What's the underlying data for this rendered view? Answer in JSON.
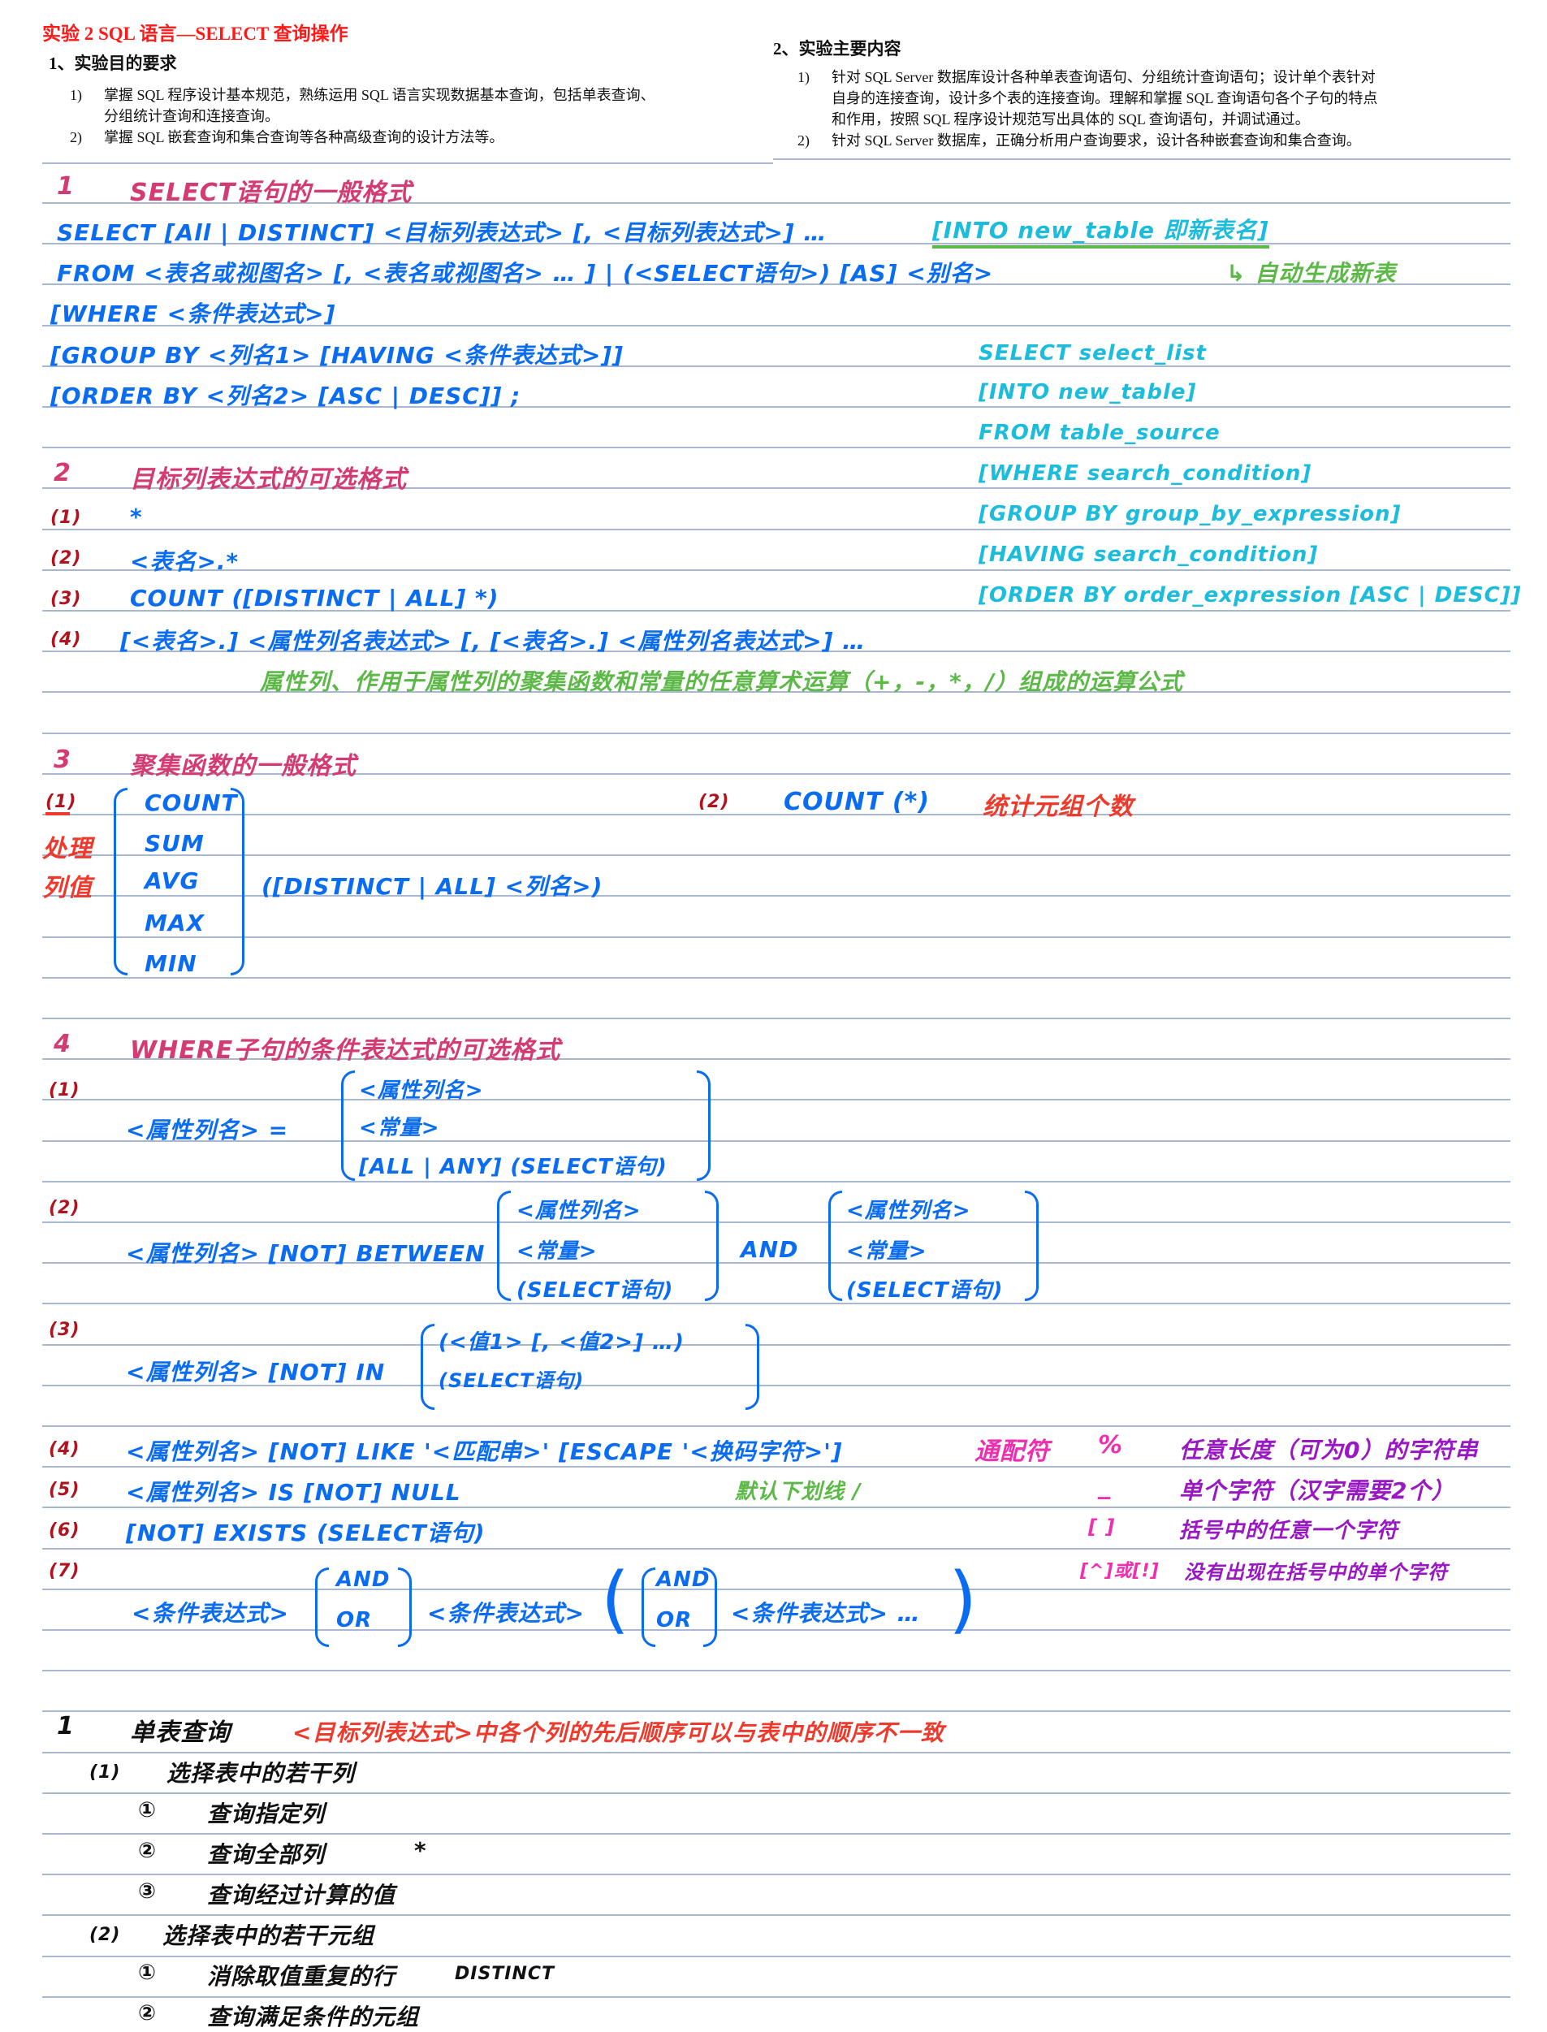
{
  "header": {
    "title": "实验 2   SQL 语言—SELECT 查询操作",
    "left": {
      "heading": "1、实验目的要求",
      "items": [
        {
          "num": "1)",
          "line1": "掌握 SQL 程序设计基本规范，熟练运用 SQL 语言实现数据基本查询，包括单表查询、",
          "line2": "分组统计查询和连接查询。"
        },
        {
          "num": "2)",
          "line1": "掌握 SQL 嵌套查询和集合查询等各种高级查询的设计方法等。"
        }
      ]
    },
    "right": {
      "heading": "2、实验主要内容",
      "items": [
        {
          "num": "1)",
          "line1": "针对 SQL Server 数据库设计各种单表查询语句、分组统计查询语句；设计单个表针对",
          "line2": "自身的连接查询，设计多个表的连接查询。理解和掌握 SQL 查询语句各个子句的特点",
          "line3": "和作用，按照 SQL 程序设计规范写出具体的 SQL 查询语句，并调试通过。"
        },
        {
          "num": "2)",
          "line1": "针对 SQL Server 数据库，正确分析用户查询要求，设计各种嵌套查询和集合查询。"
        }
      ]
    }
  },
  "section1": {
    "num": "1",
    "title": "SELECT语句的一般格式",
    "lines": [
      "SELECT [All | DISTINCT] <目标列表达式> [, <目标列表达式>] …",
      "FROM <表名或视图名> [, <表名或视图名> … ] | (<SELECT语句>) [AS] <别名>",
      "[WHERE <条件表达式>]",
      "[GROUP BY <列名1> [HAVING <条件表达式>]]",
      "[ORDER BY <列名2> [ASC | DESC]] ;"
    ],
    "into_note": "[INTO new_table 即新表名]",
    "auto_note": "↳ 自动生成新表",
    "english_syntax": [
      "SELECT select_list",
      "[INTO new_table]",
      "FROM table_source",
      "[WHERE search_condition]",
      "[GROUP BY group_by_expression]",
      "[HAVING search_condition]",
      "[ORDER BY order_expression [ASC | DESC]]"
    ]
  },
  "section2": {
    "num": "2",
    "title": "目标列表达式的可选格式",
    "items": [
      {
        "num": "(1)",
        "text": "*"
      },
      {
        "num": "(2)",
        "text": "<表名>.*"
      },
      {
        "num": "(3)",
        "text": "COUNT ([DISTINCT | ALL] *)"
      },
      {
        "num": "(4)",
        "text": "[<表名>.] <属性列名表达式> [, [<表名>.] <属性列名表达式>] …"
      }
    ],
    "note": "属性列、作用于属性列的聚集函数和常量的任意算术运算（+，-，*，/）组成的运算公式"
  },
  "section3": {
    "num": "3",
    "title": "聚集函数的一般格式",
    "item1_num": "(1)",
    "side_label": [
      "处理",
      "列值"
    ],
    "functions": [
      "COUNT",
      "SUM",
      "AVG",
      "MAX",
      "MIN"
    ],
    "args": "([DISTINCT | ALL] <列名>)",
    "item2_num": "(2)",
    "item2_code": "COUNT (*)",
    "item2_note": "统计元组个数"
  },
  "section4": {
    "num": "4",
    "title": "WHERE子句的条件表达式的可选格式",
    "f1": {
      "num": "(1)",
      "lhs": "<属性列名>  =",
      "options": [
        "<属性列名>",
        "<常量>",
        "[ALL | ANY] (SELECT语句)"
      ]
    },
    "f2": {
      "num": "(2)",
      "lhs": "<属性列名> [NOT] BETWEEN",
      "options_a": [
        "<属性列名>",
        "<常量>",
        "(SELECT语句)"
      ],
      "and": "AND",
      "options_b": [
        "<属性列名>",
        "<常量>",
        "(SELECT语句)"
      ]
    },
    "f3": {
      "num": "(3)",
      "lhs": "<属性列名> [NOT] IN",
      "options": [
        "(<值1> [, <值2>] …)",
        "(SELECT语句)"
      ]
    },
    "f4": {
      "num": "(4)",
      "text": "<属性列名> [NOT] LIKE '<匹配串>' [ESCAPE '<换码字符>']"
    },
    "f5": {
      "num": "(5)",
      "text": "<属性列名> IS [NOT] NULL",
      "note": "默认下划线 /"
    },
    "f6": {
      "num": "(6)",
      "text": "[NOT] EXISTS (SELECT语句)"
    },
    "f7": {
      "num": "(7)",
      "expr": "<条件表达式>",
      "ops": [
        "AND",
        "OR"
      ],
      "expr2": "<条件表达式>",
      "ops2": [
        "AND",
        "OR"
      ],
      "expr3": "<条件表达式> …"
    },
    "wildcards": {
      "label": "通配符",
      "rows": [
        {
          "sym": "%",
          "desc": "任意长度（可为0）的字符串"
        },
        {
          "sym": "_",
          "desc": "单个字符（汉字需要2个）"
        },
        {
          "sym": "[ ]",
          "desc": "括号中的任意一个字符"
        },
        {
          "sym": "[^]或[!]",
          "desc": "没有出现在括号中的单个字符"
        }
      ]
    }
  },
  "part1": {
    "num": "1",
    "title": "单表查询",
    "note": "<目标列表达式>中各个列的先后顺序可以与表中的顺序不一致",
    "sub1": {
      "num": "(1)",
      "title": "选择表中的若干列",
      "items": [
        {
          "num": "①",
          "text": "查询指定列",
          "extra": ""
        },
        {
          "num": "②",
          "text": "查询全部列",
          "extra": "*"
        },
        {
          "num": "③",
          "text": "查询经过计算的值",
          "extra": ""
        }
      ]
    },
    "sub2": {
      "num": "(2)",
      "title": "选择表中的若干元组",
      "items": [
        {
          "num": "①",
          "text": "消除取值重复的行",
          "extra": "DISTINCT"
        },
        {
          "num": "②",
          "text": "查询满足条件的元组",
          "extra": ""
        }
      ]
    }
  }
}
